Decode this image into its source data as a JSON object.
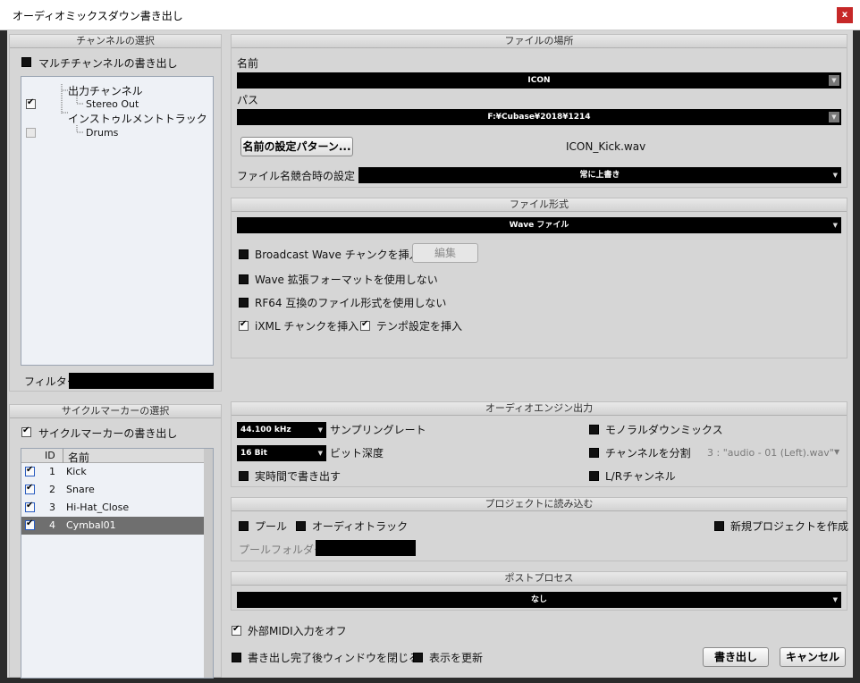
{
  "window": {
    "title": "オーディオミックスダウン書き出し",
    "close_label": "x"
  },
  "channel_select": {
    "header": "チャンネルの選択",
    "multichannel_label": "マルチチャンネルの書き出し",
    "tree": [
      {
        "label": "出力チャンネル"
      },
      {
        "label": "Stereo Out"
      },
      {
        "label": "インストゥルメントトラック"
      },
      {
        "label": "Drums"
      }
    ],
    "filter_label": "フィルター"
  },
  "cycle_markers": {
    "header": "サイクルマーカーの選択",
    "export_label": "サイクルマーカーの書き出し",
    "col_id": "ID",
    "col_name": "名前",
    "rows": [
      {
        "id": "1",
        "name": "Kick"
      },
      {
        "id": "2",
        "name": "Snare"
      },
      {
        "id": "3",
        "name": "Hi-Hat_Close"
      },
      {
        "id": "4",
        "name": "Cymbal01"
      }
    ]
  },
  "file_location": {
    "header": "ファイルの場所",
    "name_label": "名前",
    "name_value": "ICON",
    "path_label": "パス",
    "path_value": "F:¥Cubase¥2018¥1214",
    "naming_button": "名前の設定パターン...",
    "filename_preview": "ICON_Kick.wav",
    "conflict_label": "ファイル名競合時の設定",
    "conflict_value": "常に上書き"
  },
  "file_format": {
    "header": "ファイル形式",
    "format_value": "Wave ファイル",
    "broadcast_label": "Broadcast Wave チャンクを挿入",
    "edit_button": "編集",
    "no_ext_label": "Wave 拡張フォーマットを使用しない",
    "no_rf64_label": "RF64 互換のファイル形式を使用しない",
    "ixml_label": "iXML チャンクを挿入",
    "tempo_label": "テンポ設定を挿入"
  },
  "engine_output": {
    "header": "オーディオエンジン出力",
    "samplerate_value": "44.100 kHz",
    "samplerate_label": "サンプリングレート",
    "bitdepth_value": "16 Bit",
    "bitdepth_label": "ビット深度",
    "realtime_label": "実時間で書き出す",
    "mono_label": "モノラルダウンミックス",
    "split_label": "チャンネルを分割",
    "split_value": "3 : \"audio - 01 (Left).wav\"",
    "lr_label": "L/Rチャンネル"
  },
  "import_project": {
    "header": "プロジェクトに読み込む",
    "pool_label": "プール",
    "audio_track_label": "オーディオトラック",
    "new_project_label": "新規プロジェクトを作成",
    "pool_folder_label": "プールフォルダー"
  },
  "post_process": {
    "header": "ポストプロセス",
    "value": "なし"
  },
  "footer": {
    "midi_off_label": "外部MIDI入力をオフ",
    "close_after_label": "書き出し完了後ウィンドウを閉じる",
    "update_display_label": "表示を更新",
    "export_button": "書き出し",
    "cancel_button": "キャンセル"
  }
}
